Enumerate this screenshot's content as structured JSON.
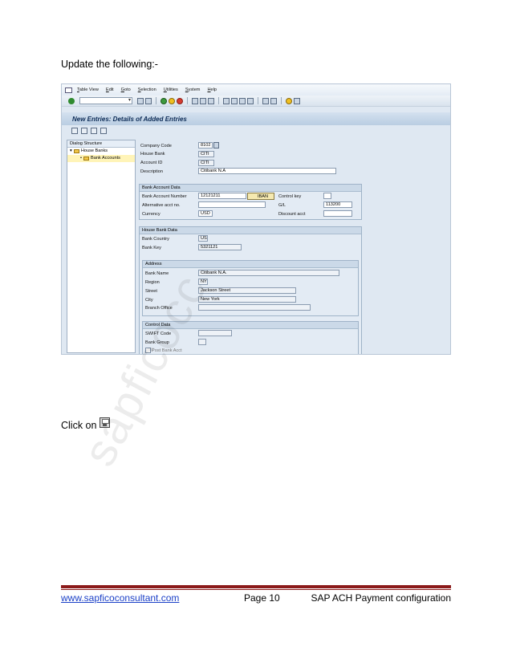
{
  "intro_text": "Update the following:-",
  "click_text": "Click on",
  "sap": {
    "menu": [
      "Table View",
      "Edit",
      "Goto",
      "Selection",
      "Utilities",
      "System",
      "Help"
    ],
    "screen_title": "New Entries: Details of Added Entries",
    "dialog": {
      "header": "Dialog Structure",
      "tree_root": "House Banks",
      "tree_child": "Bank Accounts"
    },
    "header_fields": {
      "company_code_label": "Company Code",
      "company_code_value": "8102",
      "house_bank_label": "House Bank",
      "house_bank_value": "CITI",
      "account_id_label": "Account ID",
      "account_id_value": "CITI",
      "description_label": "Description",
      "description_value": "Citibank N.A"
    },
    "bank_account_data": {
      "title": "Bank Account Data",
      "bank_account_number_label": "Bank Account Number",
      "bank_account_number_value": "12121211",
      "iban_label": "IBAN",
      "control_key_label": "Control key",
      "alt_acct_label": "Alternative acct no.",
      "gl_label": "G/L",
      "gl_value": "113200",
      "currency_label": "Currency",
      "currency_value": "USD",
      "discount_acct_label": "Discount acct"
    },
    "house_bank_data": {
      "title": "House Bank Data",
      "bank_country_label": "Bank Country",
      "bank_country_value": "US",
      "bank_key_label": "Bank Key",
      "bank_key_value": "5321121"
    },
    "address": {
      "title": "Address",
      "bank_name_label": "Bank Name",
      "bank_name_value": "Citibank N.A.",
      "region_label": "Region",
      "region_value": "NY",
      "street_label": "Street",
      "street_value": "Jackson Street",
      "city_label": "City",
      "city_value": "New York",
      "branch_office_label": "Branch Office"
    },
    "control_data": {
      "title": "Control Data",
      "swift_label": "SWIFT Code",
      "bank_group_label": "Bank Group",
      "post_bank_label": "Post Bank Acct"
    }
  },
  "watermark": "sapficocc",
  "footer": {
    "link": "www.sapficoconsultant.com",
    "page": "Page 10",
    "title": "SAP ACH Payment configuration"
  }
}
